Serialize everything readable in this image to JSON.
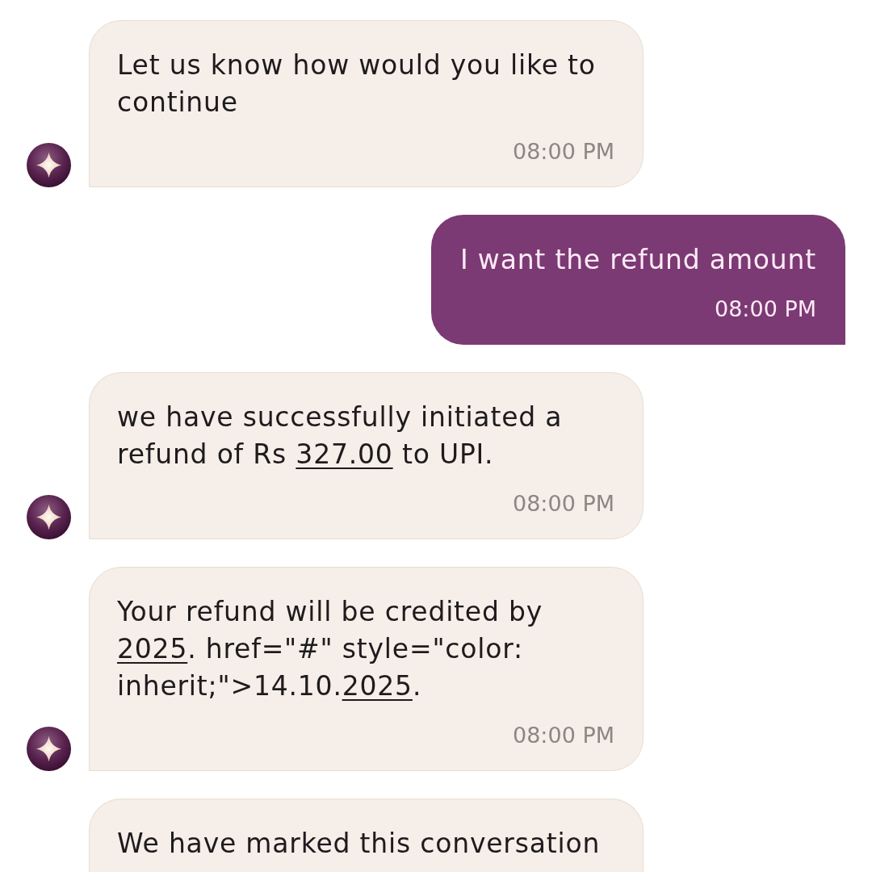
{
  "messages": [
    {
      "kind": "bot",
      "avatar": true,
      "segments": [
        {
          "kind": "text",
          "text": "Let us know how would you like to continue"
        }
      ],
      "time": "08:00 PM"
    },
    {
      "kind": "user",
      "avatar": false,
      "segments": [
        {
          "kind": "text",
          "text": "I want the refund amount"
        }
      ],
      "time": "08:00 PM"
    },
    {
      "kind": "bot",
      "avatar": true,
      "segments": [
        {
          "kind": "text",
          "text": "we have successfully initiated a refund of Rs "
        },
        {
          "kind": "link",
          "text": "327.00"
        },
        {
          "kind": "text",
          "text": " to UPI."
        }
      ],
      "time": "08:00 PM"
    },
    {
      "kind": "bot",
      "avatar": true,
      "segments": [
        {
          "kind": "text",
          "text": "Your refund will be credited by "
        },
        {
          "kind": "link",
          "text": "2025"
        },
        {
          "kind": "text",
          "text": ". href=\"#\" style=\"color: inherit;\">14.10."
        },
        {
          "kind": "link",
          "text": "2025"
        },
        {
          "kind": "text",
          "text": "."
        }
      ],
      "time": "08:00 PM"
    },
    {
      "kind": "bot",
      "avatar": false,
      "segments": [
        {
          "kind": "text",
          "text": "We have marked this conversation"
        }
      ]
    }
  ]
}
